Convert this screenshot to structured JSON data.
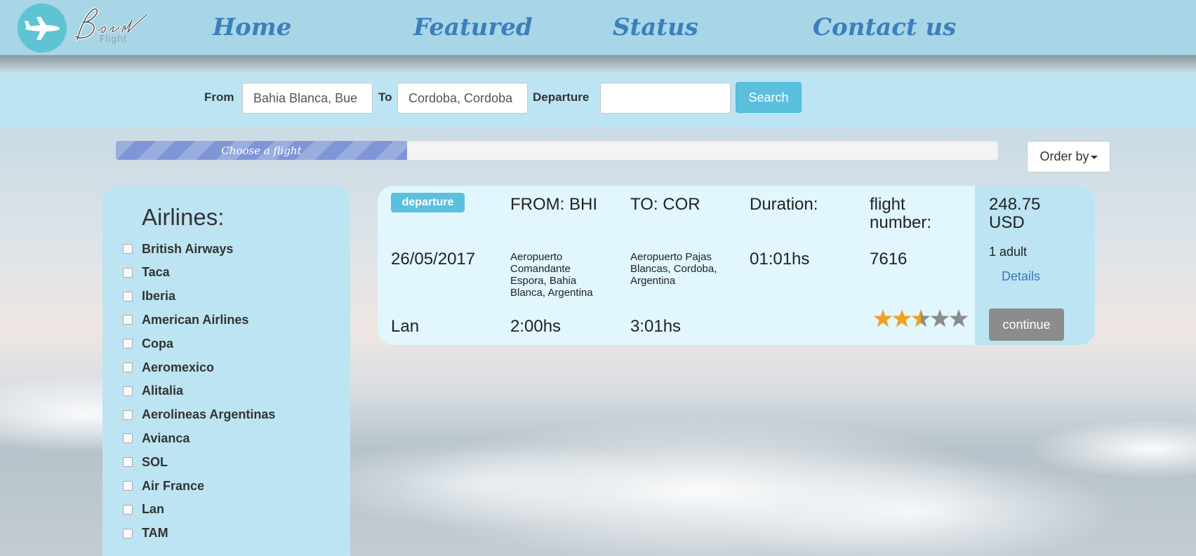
{
  "header": {
    "logo_script": "Best",
    "logo_sub": "Flight",
    "nav": [
      "Home",
      "Featured",
      "Status",
      "Contact us"
    ]
  },
  "search": {
    "from_label": "From",
    "from_value": "Bahia Blanca, Bue",
    "to_label": "To",
    "to_value": "Cordoba, Cordoba",
    "departure_label": "Departure",
    "departure_value": "",
    "button": "Search"
  },
  "progress": {
    "label": "Choose a flight",
    "percent": 33
  },
  "order_by": "Order by",
  "sidebar": {
    "title": "Airlines:",
    "airlines": [
      "British Airways",
      "Taca",
      "Iberia",
      "American Airlines",
      "Copa",
      "Aeromexico",
      "Alitalia",
      "Aerolineas Argentinas",
      "Avianca",
      "SOL",
      "Air France",
      "Lan",
      "TAM"
    ]
  },
  "flight": {
    "badge": "departure",
    "from": "FROM: BHI",
    "to": "TO: COR",
    "duration_label": "Duration:",
    "flight_number_label": "flight number:",
    "price": "248.75 USD",
    "date": "26/05/2017",
    "from_airport": "Aeropuerto Comandante Espora, Bahia Blanca, Argentina",
    "to_airport": "Aeropuerto Pajas Blancas, Cordoba, Argentina",
    "duration": "01:01hs",
    "flight_number": "7616",
    "passengers": "1 adult",
    "details": "Details",
    "airline": "Lan",
    "depart_time": "2:00hs",
    "arrive_time": "3:01hs",
    "rating": 2.5,
    "rating_max": 5,
    "continue": "continue"
  },
  "colors": {
    "header_bg": "#a9d6e6",
    "nav_text": "#3a7fbe",
    "panel_bg": "#bde4f2",
    "card_bg": "#e1f6fd",
    "accent": "#5bc0de",
    "star_on": "#f0a020",
    "star_off": "#8c8c8c"
  }
}
